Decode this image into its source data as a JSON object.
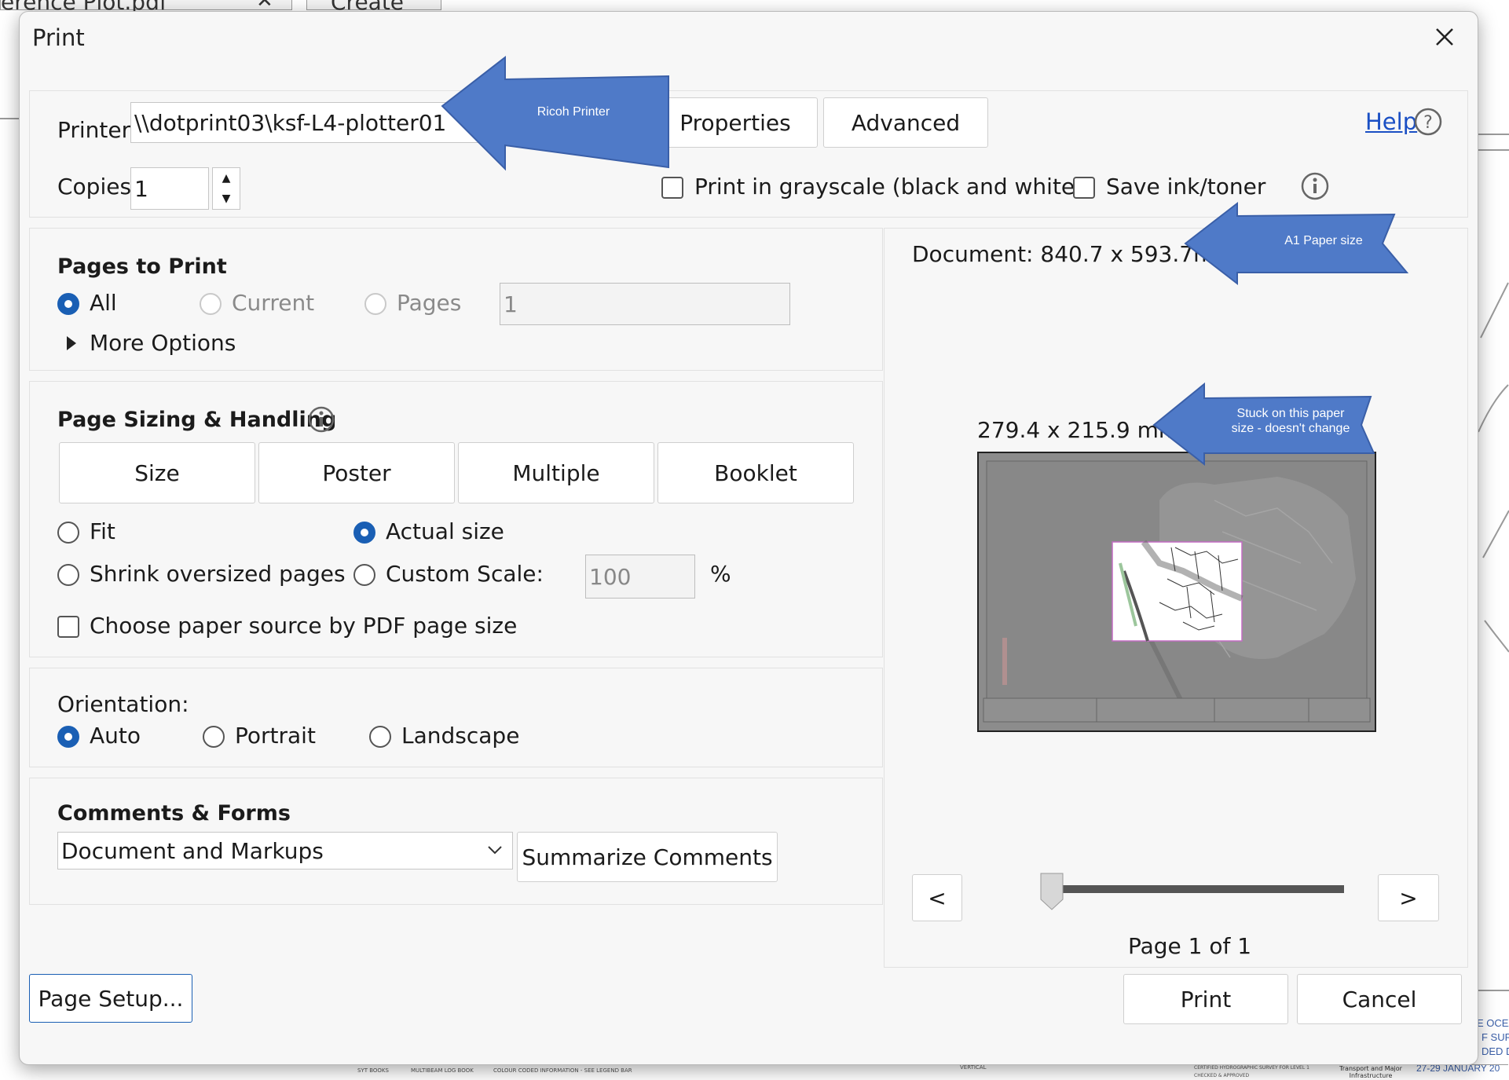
{
  "background": {
    "tab_file": "erence Plot.pdf",
    "tab_create": "Create",
    "right_text": [
      "E OCEA",
      "F SURV",
      "DED D",
      "27-29 JANUARY 20"
    ],
    "bottom_text": [
      "SYT BOOKS",
      "MULTIBEAM LOG BOOK",
      "COLOUR CODED INFORMATION - SEE LEGEND BAR",
      "CERTIFIED HYDROGRAPHIC SURVEY FOR LEVEL 1",
      "CHECKED & APPROVED",
      "Transport and Major Infrastructure",
      "VERTICAL"
    ]
  },
  "dialog": {
    "title": "Print",
    "close_icon": "close-icon"
  },
  "printer": {
    "label": "Printer:",
    "value": "\\\\dotprint03\\ksf-L4-plotter01",
    "properties_label": "Properties",
    "advanced_label": "Advanced",
    "help_label": "Help",
    "copies_label": "Copies:",
    "copies_value": "1",
    "grayscale_label": "Print in grayscale (black and white)",
    "save_ink_label": "Save ink/toner"
  },
  "annotations": {
    "printer_callout": "Ricoh Printer",
    "paper_callout": "A1 Paper size",
    "stuck_callout_line1": "Stuck on this paper",
    "stuck_callout_line2": "size - doesn't change",
    "color": "#4f7ac8"
  },
  "pages_to_print": {
    "heading": "Pages to Print",
    "all_label": "All",
    "current_label": "Current",
    "pages_label": "Pages",
    "pages_value": "1",
    "more_options_label": "More Options"
  },
  "page_sizing": {
    "heading": "Page Sizing & Handling",
    "tabs": [
      "Size",
      "Poster",
      "Multiple",
      "Booklet"
    ],
    "fit_label": "Fit",
    "actual_size_label": "Actual size",
    "shrink_label": "Shrink oversized pages",
    "custom_scale_label": "Custom Scale:",
    "scale_value": "100",
    "percent_label": "%",
    "paper_source_label": "Choose paper source by PDF page size"
  },
  "orientation": {
    "heading": "Orientation:",
    "auto_label": "Auto",
    "portrait_label": "Portrait",
    "landscape_label": "Landscape"
  },
  "comments_forms": {
    "heading": "Comments & Forms",
    "selected": "Document and Markups",
    "summarize_label": "Summarize Comments"
  },
  "preview": {
    "document_size": "Document: 840.7 x 593.7mm",
    "paper_size": "279.4 x 215.9 mm",
    "prev_label": "<",
    "next_label": ">",
    "page_info": "Page 1 of 1",
    "slider_position": 0
  },
  "footer": {
    "page_setup_label": "Page Setup...",
    "print_label": "Print",
    "cancel_label": "Cancel"
  },
  "colors": {
    "accent": "#1a5fb4",
    "link": "#1a4fc4"
  }
}
